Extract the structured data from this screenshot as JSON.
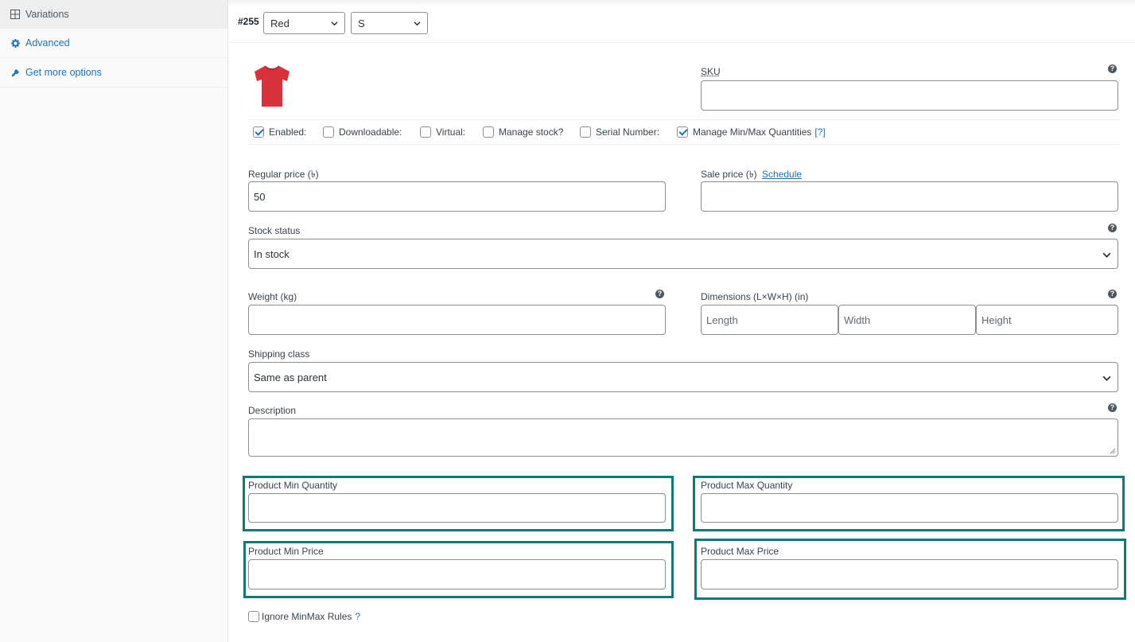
{
  "sidebar": {
    "items": [
      {
        "label": "Variations",
        "icon": "grid-icon"
      },
      {
        "label": "Advanced",
        "icon": "gear-icon"
      },
      {
        "label": "Get more options",
        "icon": "plugin-icon"
      }
    ]
  },
  "variation": {
    "id": "#255",
    "color_value": "Red",
    "size_value": "S"
  },
  "sku": {
    "label": "SKU",
    "value": ""
  },
  "options": {
    "enabled": {
      "label": "Enabled:",
      "checked": true
    },
    "downloadable": {
      "label": "Downloadable:",
      "checked": false
    },
    "virtual": {
      "label": "Virtual:",
      "checked": false
    },
    "manage_stock": {
      "label": "Manage stock?",
      "checked": false
    },
    "serial_number": {
      "label": "Serial Number:",
      "checked": false
    },
    "manage_minmax": {
      "label": "Manage Min/Max Quantities",
      "checked": true,
      "help_link": "[?]"
    }
  },
  "regular_price": {
    "label": "Regular price (৳)",
    "value": "50"
  },
  "sale_price": {
    "label": "Sale price (৳)",
    "schedule_link": "Schedule",
    "value": ""
  },
  "stock_status": {
    "label": "Stock status",
    "value": "In stock"
  },
  "weight": {
    "label": "Weight (kg)",
    "value": ""
  },
  "dimensions": {
    "label": "Dimensions (L×W×H) (in)",
    "length_placeholder": "Length",
    "width_placeholder": "Width",
    "height_placeholder": "Height"
  },
  "shipping_class": {
    "label": "Shipping class",
    "value": "Same as parent"
  },
  "description": {
    "label": "Description",
    "value": ""
  },
  "minmax": {
    "min_qty_label": "Product Min Quantity",
    "max_qty_label": "Product Max Quantity",
    "min_price_label": "Product Min Price",
    "max_price_label": "Product Max Price",
    "ignore_label": "Ignore MinMax Rules",
    "ignore_help": "?"
  },
  "colors": {
    "accent": "#2271b1",
    "highlight": "#0b7b78",
    "tshirt": "#d9323d"
  }
}
